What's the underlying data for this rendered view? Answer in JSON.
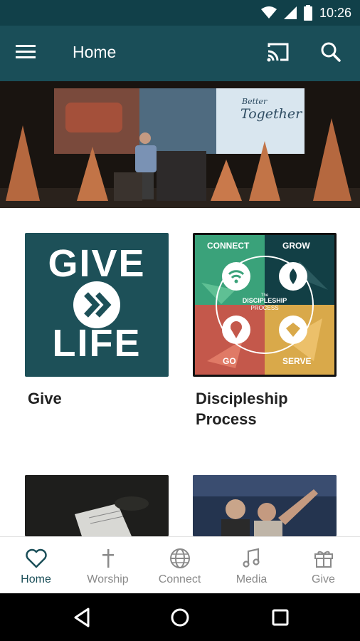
{
  "status_bar": {
    "time": "10:26",
    "icons": [
      "wifi-icon",
      "signal-icon",
      "battery-icon"
    ]
  },
  "app_bar": {
    "title": "Home",
    "menu_icon": "menu-icon",
    "cast_icon": "cast-icon",
    "search_icon": "search-icon"
  },
  "hero": {
    "banner_line1": "Better",
    "banner_line2": "Together"
  },
  "cards": [
    {
      "label": "Give",
      "thumb_line1": "GIVE",
      "thumb_line2": "LIFE"
    },
    {
      "label": "Discipleship Process",
      "quadrants": [
        "CONNECT",
        "GROW",
        "GO",
        "SERVE"
      ],
      "center_small": "The",
      "center_line1": "DISCIPLESHIP",
      "center_line2": "PROCESS"
    },
    {
      "label": ""
    },
    {
      "label": ""
    }
  ],
  "bottom_nav": [
    {
      "label": "Home",
      "icon": "heart-icon",
      "active": true
    },
    {
      "label": "Worship",
      "icon": "cross-icon",
      "active": false
    },
    {
      "label": "Connect",
      "icon": "globe-icon",
      "active": false
    },
    {
      "label": "Media",
      "icon": "music-note-icon",
      "active": false
    },
    {
      "label": "Give",
      "icon": "gift-icon",
      "active": false
    }
  ],
  "colors": {
    "status_bar": "#114049",
    "app_bar": "#1a4e58",
    "active_nav": "#1a4e58",
    "inactive_nav": "#8a8a8a"
  }
}
